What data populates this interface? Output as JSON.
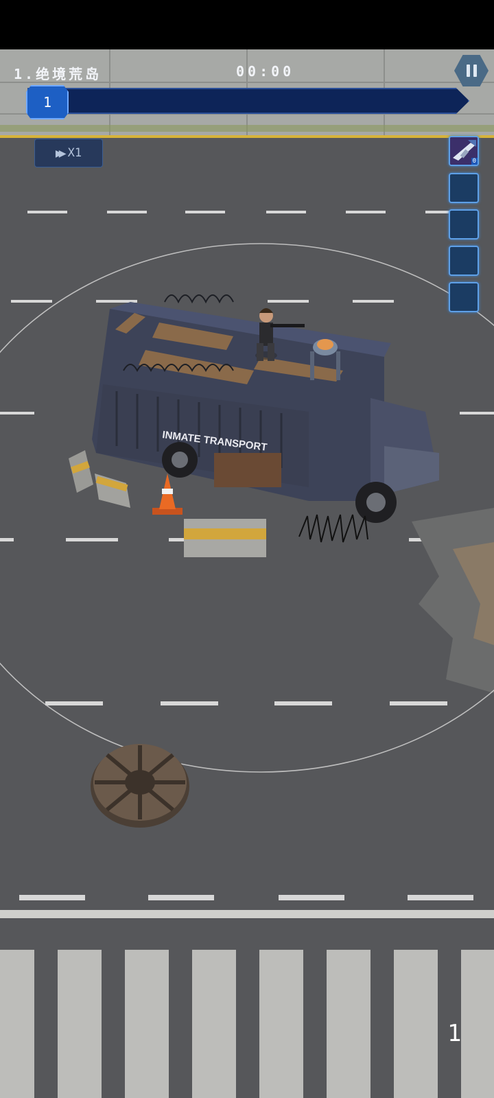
{
  "hud": {
    "level_title": "1.绝境荒岛",
    "timer": "00:00",
    "wave_number": "1",
    "wave_progress": 0.05,
    "speed_label": "X1",
    "corner_number": "1"
  },
  "skill_slots": [
    {
      "state": "filled",
      "icon": "rifle-icon",
      "count": "0"
    },
    {
      "state": "empty"
    },
    {
      "state": "empty"
    },
    {
      "state": "empty"
    },
    {
      "state": "empty"
    }
  ],
  "scene": {
    "bus_label": "INMATE TRANSPORT"
  },
  "colors": {
    "road": "#56575a",
    "hud_blue": "#1d5fc4",
    "progress_track": "#0d2458",
    "slot_border": "#5ea0e8"
  }
}
